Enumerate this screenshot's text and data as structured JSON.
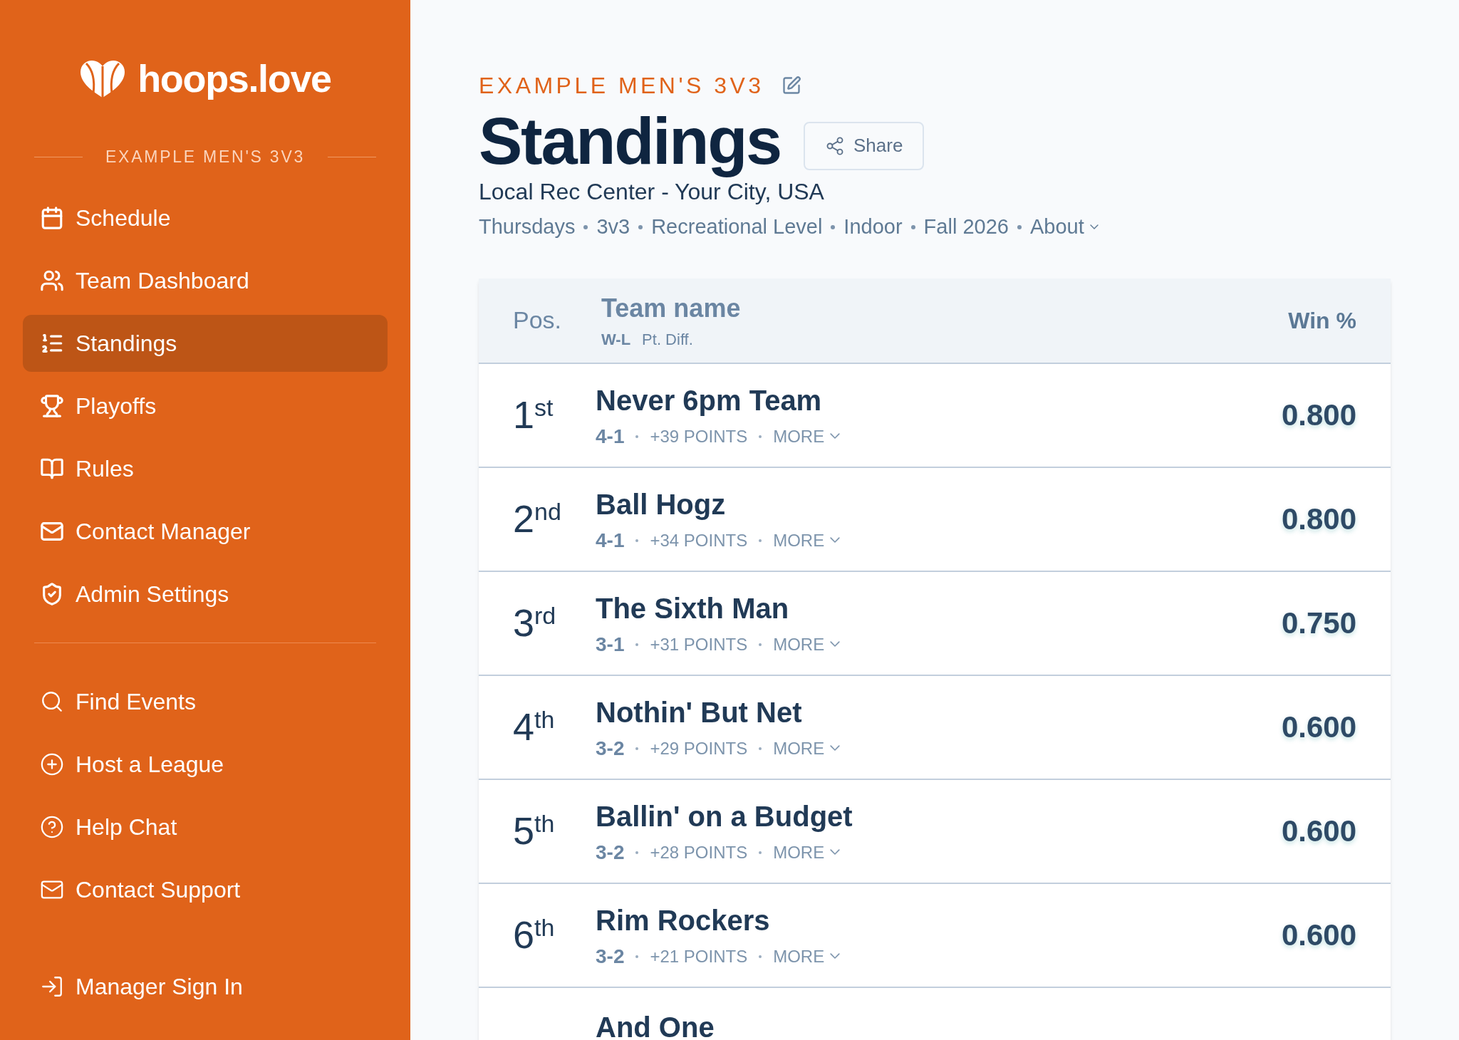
{
  "sidebar": {
    "logo_text": "hoops.love",
    "league": "EXAMPLE MEN'S 3V3",
    "items": [
      {
        "label": "Schedule",
        "selected": false
      },
      {
        "label": "Team Dashboard",
        "selected": false
      },
      {
        "label": "Standings",
        "selected": true
      },
      {
        "label": "Playoffs",
        "selected": false
      },
      {
        "label": "Rules",
        "selected": false
      },
      {
        "label": "Contact Manager",
        "selected": false
      },
      {
        "label": "Admin Settings",
        "selected": false
      }
    ],
    "links": [
      {
        "label": "Find Events"
      },
      {
        "label": "Host a League"
      },
      {
        "label": "Help Chat"
      },
      {
        "label": "Contact Support"
      }
    ],
    "sign_in": "Manager Sign In"
  },
  "header": {
    "league": "EXAMPLE MEN'S 3V3",
    "title": "Standings",
    "share": "Share",
    "venue": "Local Rec Center - Your City, USA",
    "meta": [
      "Thursdays",
      "3v3",
      "Recreational Level",
      "Indoor",
      "Fall 2026"
    ],
    "about": "About"
  },
  "table": {
    "columns": {
      "pos": "Pos.",
      "team": "Team name",
      "wl": "W-L",
      "diff": "Pt. Diff.",
      "win": "Win %"
    },
    "rows": [
      {
        "pos": "1$^{st}$",
        "team": "Never 6pm Team",
        "record": "4-1",
        "points": "+39 POINTS",
        "more": "MORE",
        "win": "0.800"
      },
      {
        "pos": "2$^{nd}$",
        "team": "Ball Hogz",
        "record": "4-1",
        "points": "+34 POINTS",
        "more": "MORE",
        "win": "0.800"
      },
      {
        "pos": "3$^{rd}$",
        "team": "The Sixth Man",
        "record": "3-1",
        "points": "+31 POINTS",
        "more": "MORE",
        "win": "0.750"
      },
      {
        "pos": "4$^{th}$",
        "team": "Nothin' But Net",
        "record": "3-2",
        "points": "+29 POINTS",
        "more": "MORE",
        "win": "0.600"
      },
      {
        "pos": "5$^{th}$",
        "team": "Ballin' on a Budget",
        "record": "3-2",
        "points": "+28 POINTS",
        "more": "MORE",
        "win": "0.600"
      },
      {
        "pos": "6$^{th}$",
        "team": "Rim Rockers",
        "record": "3-2",
        "points": "+21 POINTS",
        "more": "MORE",
        "win": "0.600"
      },
      {
        "team": "And One"
      }
    ]
  }
}
